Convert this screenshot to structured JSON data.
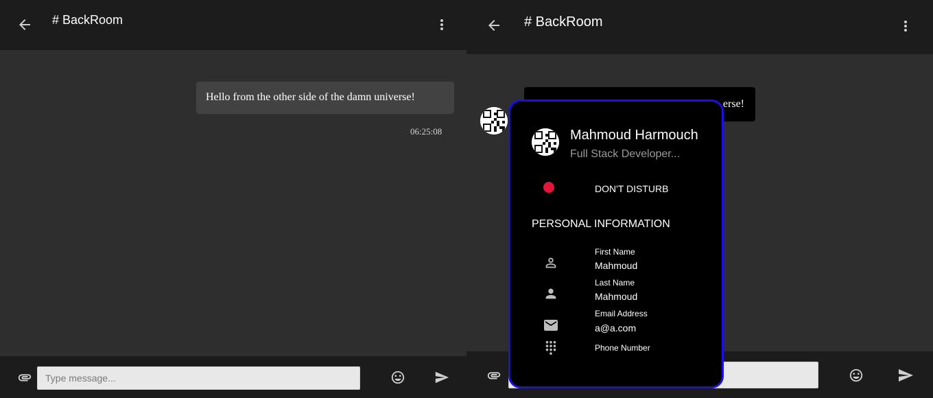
{
  "left_panel": {
    "header": {
      "title": "# BackRoom",
      "back_icon": "arrow-left-icon",
      "menu_icon": "more-vert-icon"
    },
    "message": {
      "text": "Hello from the other side of the damn universe!",
      "time": "06:25:08"
    },
    "footer": {
      "attach_icon": "paperclip-icon",
      "input_placeholder": "Type message...",
      "input_value": "",
      "emoji_icon": "emoji-icon",
      "send_icon": "send-icon"
    }
  },
  "right_panel": {
    "header": {
      "title": "# BackRoom",
      "back_icon": "arrow-left-icon",
      "menu_icon": "more-vert-icon"
    },
    "message": {
      "visible_text": "erse!"
    },
    "footer": {
      "attach_icon": "paperclip-icon",
      "emoji_icon": "emoji-icon",
      "send_icon": "send-icon"
    }
  },
  "profile_card": {
    "name": "Mahmoud Harmouch",
    "bio": "Full Stack Developer...",
    "status": {
      "label": "DON'T DISTURB",
      "color": "#e4143a"
    },
    "section_title": "PERSONAL INFORMATION",
    "fields": [
      {
        "label": "First Name",
        "value": "Mahmoud",
        "icon": "person-outline-icon"
      },
      {
        "label": "Last Name",
        "value": "Mahmoud",
        "icon": "person-icon"
      },
      {
        "label": "Email Address",
        "value": "a@a.com",
        "icon": "mail-icon"
      },
      {
        "label": "Phone Number",
        "value": "",
        "icon": "dialpad-icon"
      }
    ]
  },
  "colors": {
    "header_bg": "#1c1c1c",
    "chat_bg": "#2f2e2f",
    "bubble_bg": "#424242",
    "card_bg": "#000000",
    "card_border": "#1a10e6",
    "input_bg": "#e8e8e8"
  }
}
